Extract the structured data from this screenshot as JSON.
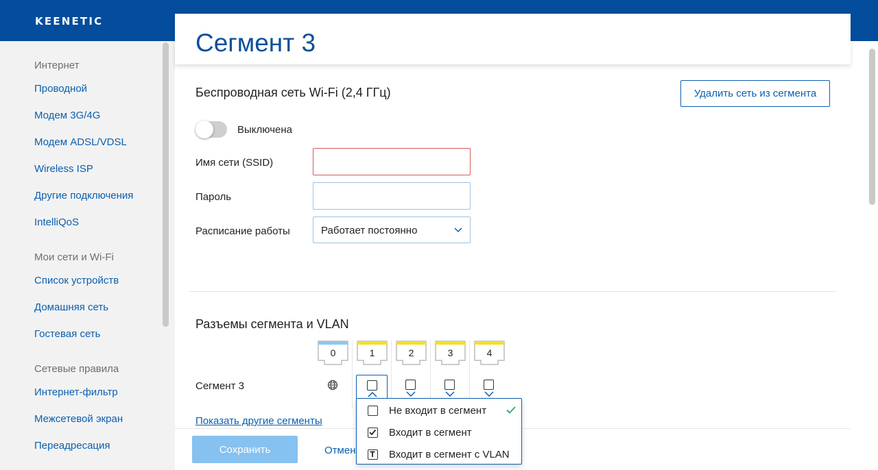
{
  "header": {
    "logo": "KEENETIC",
    "brand_color": "#034d9c"
  },
  "sidebar": {
    "groups": [
      {
        "title": "Интернет",
        "items": [
          "Проводной",
          "Модем 3G/4G",
          "Модем ADSL/VDSL",
          "Wireless ISP",
          "Другие подключения",
          "IntelliQoS"
        ]
      },
      {
        "title": "Мои сети и Wi-Fi",
        "items": [
          "Список устройств",
          "Домашняя сеть",
          "Гостевая сеть"
        ]
      },
      {
        "title": "Сетевые правила",
        "items": [
          "Интернет-фильтр",
          "Межсетевой экран",
          "Переадресация"
        ]
      }
    ]
  },
  "page": {
    "title": "Сегмент 3"
  },
  "wifi": {
    "title": "Беспроводная сеть Wi-Fi (2,4 ГГц)",
    "remove_button": "Удалить сеть из сегмента",
    "toggle_state": "Выключена",
    "ssid_label": "Имя сети (SSID)",
    "ssid_value": "",
    "password_label": "Пароль",
    "password_value": "",
    "schedule_label": "Расписание работы",
    "schedule_value": "Работает постоянно"
  },
  "ports": {
    "title": "Разъемы сегмента и VLAN",
    "port_labels": [
      "0",
      "1",
      "2",
      "3",
      "4"
    ],
    "segment_label": "Сегмент 3",
    "show_other_segments": "Показать другие сегменты",
    "colors": {
      "wan": "#8cc8f0",
      "lan": "#f4df2a"
    }
  },
  "dropdown_menu": {
    "items": [
      {
        "label": "Не входит в сегмент",
        "icon": "checkbox-empty-icon",
        "selected": true
      },
      {
        "label": "Входит в сегмент",
        "icon": "checkbox-checked-icon",
        "selected": false
      },
      {
        "label": "Входит в сегмент с VLAN",
        "icon": "checkbox-tagged-icon",
        "selected": false
      }
    ]
  },
  "footer": {
    "save": "Сохранить",
    "cancel": "Отмена"
  }
}
